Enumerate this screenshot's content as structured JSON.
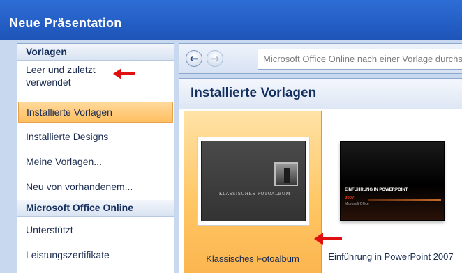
{
  "window": {
    "title": "Neue Präsentation"
  },
  "sidebar": {
    "section_templates": "Vorlagen",
    "items": [
      {
        "label": "Leer und zuletzt verwendet"
      },
      {
        "label": "Installierte Vorlagen"
      },
      {
        "label": "Installierte Designs"
      },
      {
        "label": "Meine Vorlagen..."
      },
      {
        "label": "Neu von vorhandenem..."
      }
    ],
    "section_online": "Microsoft Office Online",
    "online_items": [
      {
        "label": "Unterstützt"
      },
      {
        "label": "Leistungszertifikate"
      }
    ]
  },
  "navbar": {
    "back_icon": "back-arrow-icon",
    "forward_icon": "forward-arrow-icon",
    "search_placeholder": "Microsoft Office Online nach einer Vorlage durchsuchen"
  },
  "content": {
    "title": "Installierte Vorlagen",
    "templates": [
      {
        "label": "Klassisches Fotoalbum",
        "thumb_caption": "KLASSISCHES FOTOALBUM"
      },
      {
        "label": "Einführung in PowerPoint 2007",
        "thumb_title": "EINFÜHRUNG IN POWERPOINT",
        "thumb_year": "2007",
        "thumb_sub": "Microsoft Office"
      }
    ]
  },
  "colors": {
    "titlebar": "#2e6dd6",
    "selection": "#ffbf61",
    "annotation_arrow": "#e01010"
  }
}
